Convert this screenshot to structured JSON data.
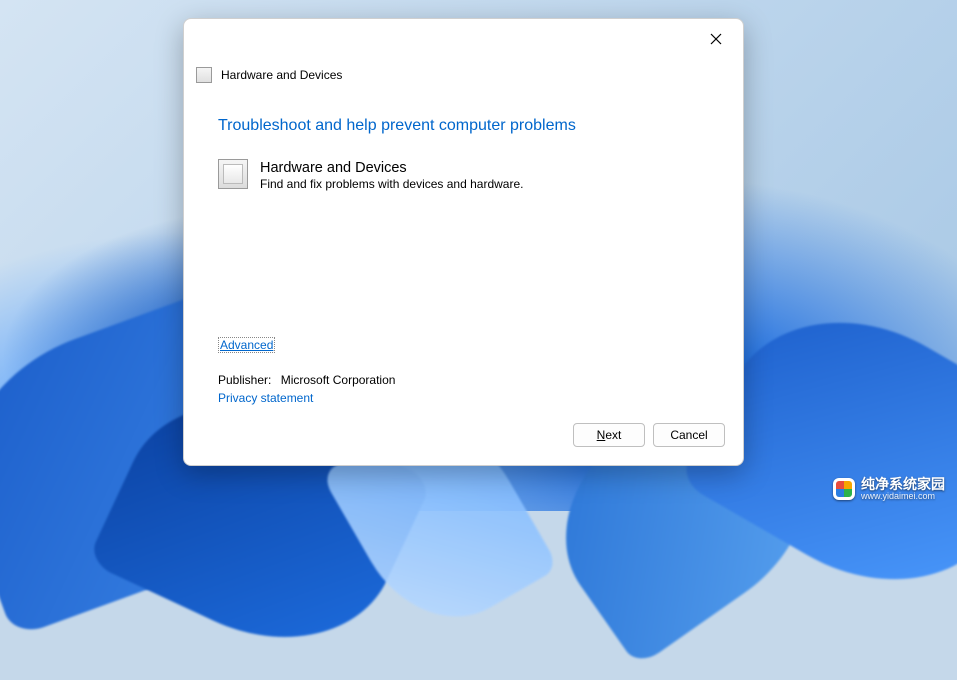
{
  "header": {
    "title": "Hardware and Devices"
  },
  "content": {
    "headline": "Troubleshoot and help prevent computer problems",
    "item": {
      "title": "Hardware and Devices",
      "description": "Find and fix problems with devices and hardware."
    },
    "advanced_label": "Advanced",
    "publisher_label": "Publisher:",
    "publisher_value": "Microsoft Corporation",
    "privacy_label": "Privacy statement"
  },
  "footer": {
    "next_prefix": "N",
    "next_rest": "ext",
    "cancel": "Cancel"
  },
  "watermark": {
    "line1": "纯净系统家园",
    "line2": "www.yidaimei.com"
  }
}
